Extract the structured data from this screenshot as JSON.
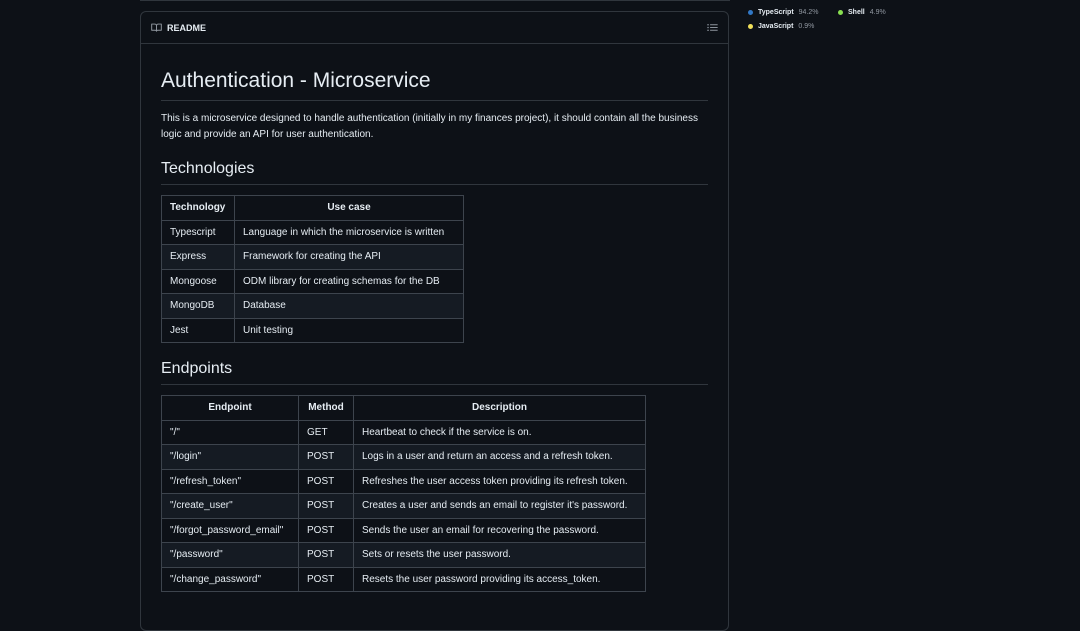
{
  "readme": {
    "tab_label": "README",
    "title": "Authentication - Microservice",
    "intro": "This is a microservice designed to handle authentication (initially in my finances project), it should contain all the business logic and provide an API for user authentication.",
    "technologies_heading": "Technologies",
    "technologies_table": {
      "headers": [
        "Technology",
        "Use case"
      ],
      "rows": [
        [
          "Typescript",
          "Language in which the microservice is written"
        ],
        [
          "Express",
          "Framework for creating the API"
        ],
        [
          "Mongoose",
          "ODM library for creating schemas for the DB"
        ],
        [
          "MongoDB",
          "Database"
        ],
        [
          "Jest",
          "Unit testing"
        ]
      ]
    },
    "endpoints_heading": "Endpoints",
    "endpoints_table": {
      "headers": [
        "Endpoint",
        "Method",
        "Description"
      ],
      "rows": [
        [
          "\"/\"",
          "GET",
          "Heartbeat to check if the service is on."
        ],
        [
          "\"/login\"",
          "POST",
          "Logs in a user and return an access and a refresh token."
        ],
        [
          "\"/refresh_token\"",
          "POST",
          "Refreshes the user access token providing its refresh token."
        ],
        [
          "\"/create_user\"",
          "POST",
          "Creates a user and sends an email to register it's password."
        ],
        [
          "\"/forgot_password_email\"",
          "POST",
          "Sends the user an email for recovering the password."
        ],
        [
          "\"/password\"",
          "POST",
          "Sets or resets the user password."
        ],
        [
          "\"/change_password\"",
          "POST",
          "Resets the user password providing its access_token."
        ]
      ]
    }
  },
  "languages": [
    {
      "name": "TypeScript",
      "percent": "94.2%",
      "color": "#3178c6"
    },
    {
      "name": "Shell",
      "percent": "4.9%",
      "color": "#89e051"
    },
    {
      "name": "JavaScript",
      "percent": "0.9%",
      "color": "#f1e05a"
    }
  ],
  "icons": {
    "tab": "book-icon",
    "outline": "list-unordered-icon"
  }
}
